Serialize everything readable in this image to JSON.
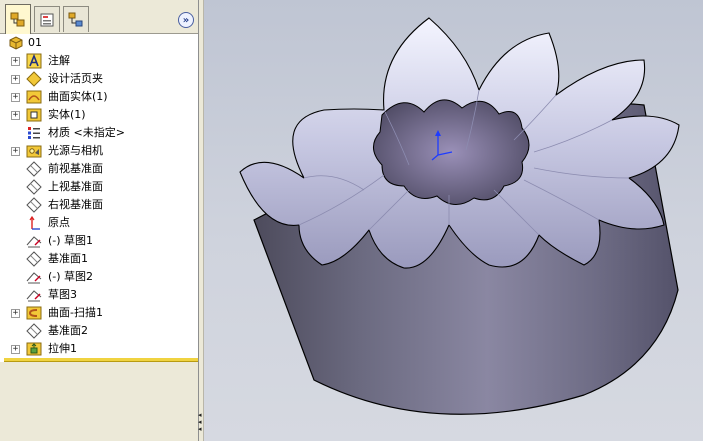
{
  "feature_manager": {
    "tabs": [
      {
        "name": "feature-manager-tab",
        "active": true
      },
      {
        "name": "property-manager-tab",
        "active": false
      },
      {
        "name": "configuration-manager-tab",
        "active": false
      }
    ],
    "expand_glyph": "»",
    "root": {
      "label": "01",
      "icon": "part-icon"
    },
    "items": [
      {
        "label": "注解",
        "icon": "annotation-icon",
        "expandable": true
      },
      {
        "label": "设计活页夹",
        "icon": "design-binder-icon",
        "expandable": true
      },
      {
        "label": "曲面实体(1)",
        "icon": "surface-bodies-icon",
        "expandable": true
      },
      {
        "label": "实体(1)",
        "icon": "solid-bodies-icon",
        "expandable": true
      },
      {
        "label": "材质 <未指定>",
        "icon": "material-icon",
        "expandable": false
      },
      {
        "label": "光源与相机",
        "icon": "lights-cameras-icon",
        "expandable": true
      },
      {
        "label": "前视基准面",
        "icon": "plane-icon",
        "expandable": false
      },
      {
        "label": "上视基准面",
        "icon": "plane-icon",
        "expandable": false
      },
      {
        "label": "右视基准面",
        "icon": "plane-icon",
        "expandable": false
      },
      {
        "label": "原点",
        "icon": "origin-icon",
        "expandable": false
      },
      {
        "label": "(-) 草图1",
        "icon": "sketch-icon",
        "expandable": false
      },
      {
        "label": "基准面1",
        "icon": "plane-icon",
        "expandable": false
      },
      {
        "label": "(-) 草图2",
        "icon": "sketch-icon",
        "expandable": false
      },
      {
        "label": "草图3",
        "icon": "sketch-icon",
        "expandable": false
      },
      {
        "label": "曲面-扫描1",
        "icon": "surface-sweep-icon",
        "expandable": true
      },
      {
        "label": "基准面2",
        "icon": "plane-icon",
        "expandable": false
      },
      {
        "label": "拉伸1",
        "icon": "extrude-icon",
        "expandable": true
      }
    ]
  },
  "colors": {
    "accent": "#f0d340",
    "viewport_bg": "#c8cdd8",
    "model_face": "#7a7991",
    "triad_blue": "#1e3cff"
  },
  "expander_glyph": "+"
}
